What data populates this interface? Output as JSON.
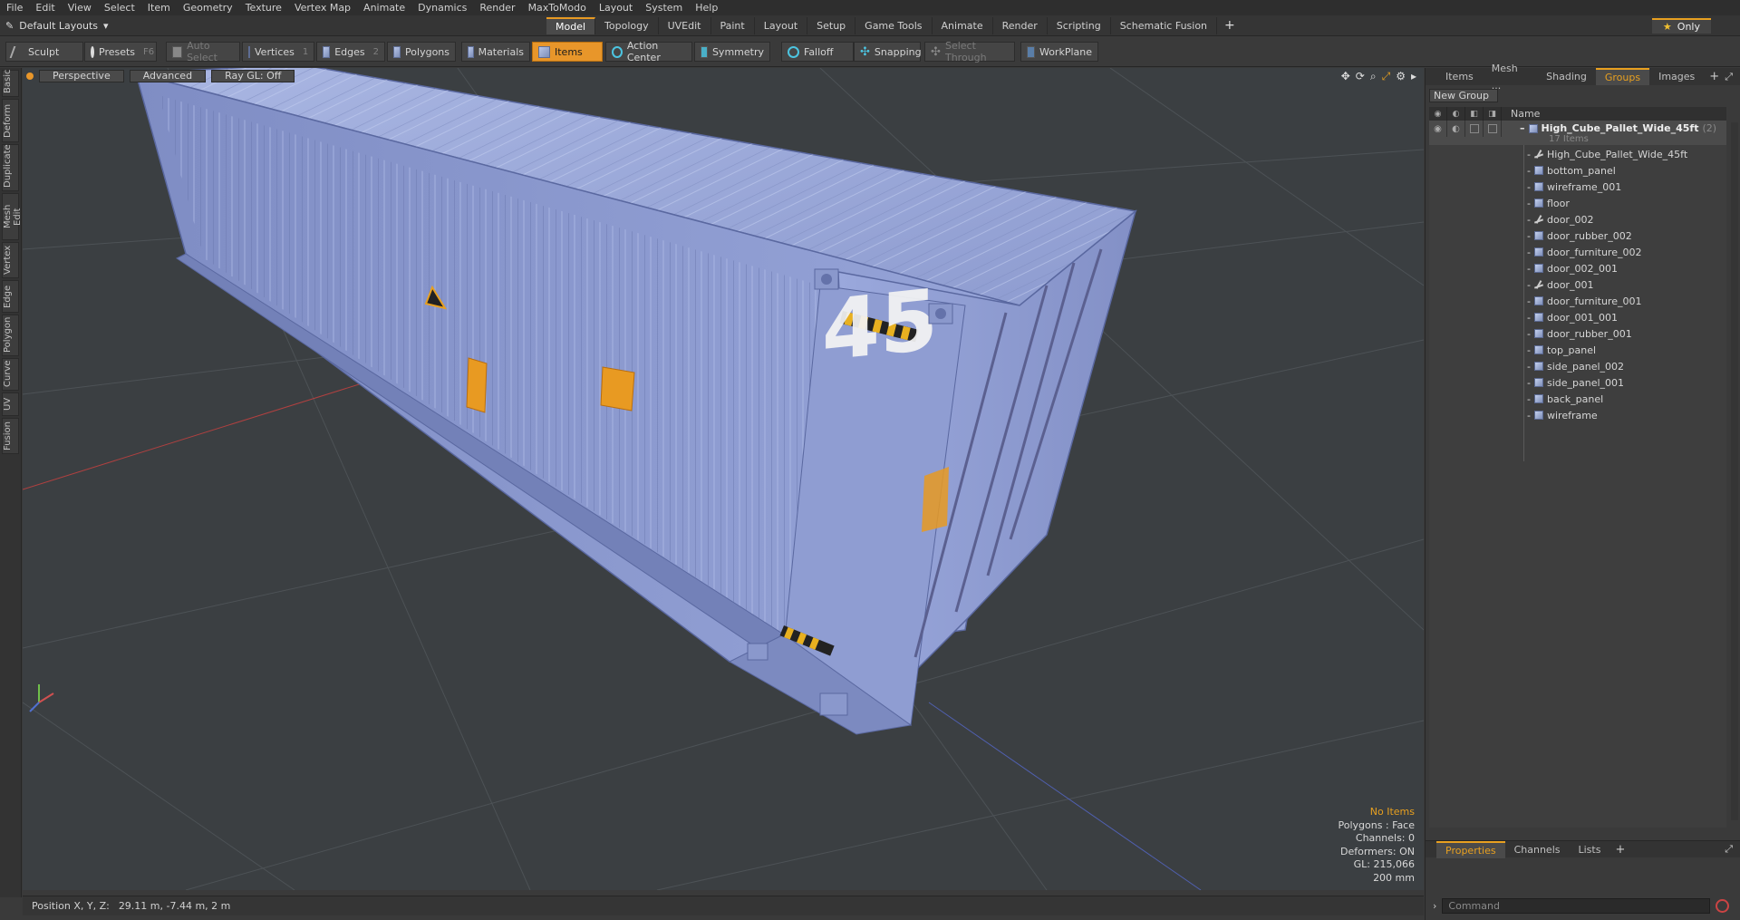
{
  "menu": [
    "File",
    "Edit",
    "View",
    "Select",
    "Item",
    "Geometry",
    "Texture",
    "Vertex Map",
    "Animate",
    "Dynamics",
    "Render",
    "MaxToModo",
    "Layout",
    "System",
    "Help"
  ],
  "layout_dropdown": "Default Layouts",
  "layout_tabs": [
    "Model",
    "Topology",
    "UVEdit",
    "Paint",
    "Layout",
    "Setup",
    "Game Tools",
    "Animate",
    "Render",
    "Scripting",
    "Schematic Fusion"
  ],
  "layout_active": "Model",
  "only_label": "Only",
  "toolbar": {
    "sculpt": "Sculpt",
    "presets": "Presets",
    "presets_key": "F6",
    "auto_select": "Auto Select",
    "vertices": "Vertices",
    "vertices_key": "1",
    "edges": "Edges",
    "edges_key": "2",
    "polygons": "Polygons",
    "materials": "Materials",
    "items": "Items",
    "action_center": "Action Center",
    "symmetry": "Symmetry",
    "falloff": "Falloff",
    "snapping": "Snapping",
    "select_through": "Select Through",
    "workplane": "WorkPlane"
  },
  "left_tabs": [
    "Basic",
    "Deform",
    "Duplicate",
    "Mesh Edit",
    "Vertex",
    "Edge",
    "Polygon",
    "Curve",
    "UV",
    "Fusion"
  ],
  "viewport": {
    "perspective": "Perspective",
    "advanced": "Advanced",
    "raygl": "Ray GL: Off",
    "decal_number": "45",
    "info": {
      "no_items": "No Items",
      "polygons": "Polygons : Face",
      "channels": "Channels: 0",
      "deformers": "Deformers: ON",
      "gl": "GL: 215,066",
      "scale": "200 mm"
    }
  },
  "status": {
    "label": "Position X, Y, Z:",
    "value": "29.11 m, -7.44 m, 2 m"
  },
  "right_panel": {
    "tabs": [
      "Items",
      "Mesh ...",
      "Shading",
      "Groups",
      "Images"
    ],
    "active_tab": "Groups",
    "new_group": "New Group",
    "col_name": "Name",
    "group": {
      "name": "High_Cube_Pallet_Wide_45ft",
      "suffix": "(2)",
      "count": "17 Items"
    },
    "items": [
      {
        "name": "High_Cube_Pallet_Wide_45ft",
        "icon": "locator-icon"
      },
      {
        "name": "bottom_panel",
        "icon": "mesh-icon"
      },
      {
        "name": "wireframe_001",
        "icon": "mesh-icon"
      },
      {
        "name": "floor",
        "icon": "mesh-icon"
      },
      {
        "name": "door_002",
        "icon": "locator-icon"
      },
      {
        "name": "door_rubber_002",
        "icon": "mesh-icon"
      },
      {
        "name": "door_furniture_002",
        "icon": "mesh-icon"
      },
      {
        "name": "door_002_001",
        "icon": "mesh-icon"
      },
      {
        "name": "door_001",
        "icon": "locator-icon"
      },
      {
        "name": "door_furniture_001",
        "icon": "mesh-icon"
      },
      {
        "name": "door_001_001",
        "icon": "mesh-icon"
      },
      {
        "name": "door_rubber_001",
        "icon": "mesh-icon"
      },
      {
        "name": "top_panel",
        "icon": "mesh-icon"
      },
      {
        "name": "side_panel_002",
        "icon": "mesh-icon"
      },
      {
        "name": "side_panel_001",
        "icon": "mesh-icon"
      },
      {
        "name": "back_panel",
        "icon": "mesh-icon"
      },
      {
        "name": "wireframe",
        "icon": "mesh-icon"
      }
    ],
    "bottom_tabs": [
      "Properties",
      "Channels",
      "Lists"
    ],
    "bottom_active": "Properties",
    "command_placeholder": "Command"
  },
  "colors": {
    "accent": "#e8962a",
    "mesh": "#9aaae0",
    "background": "#3b3f42"
  }
}
